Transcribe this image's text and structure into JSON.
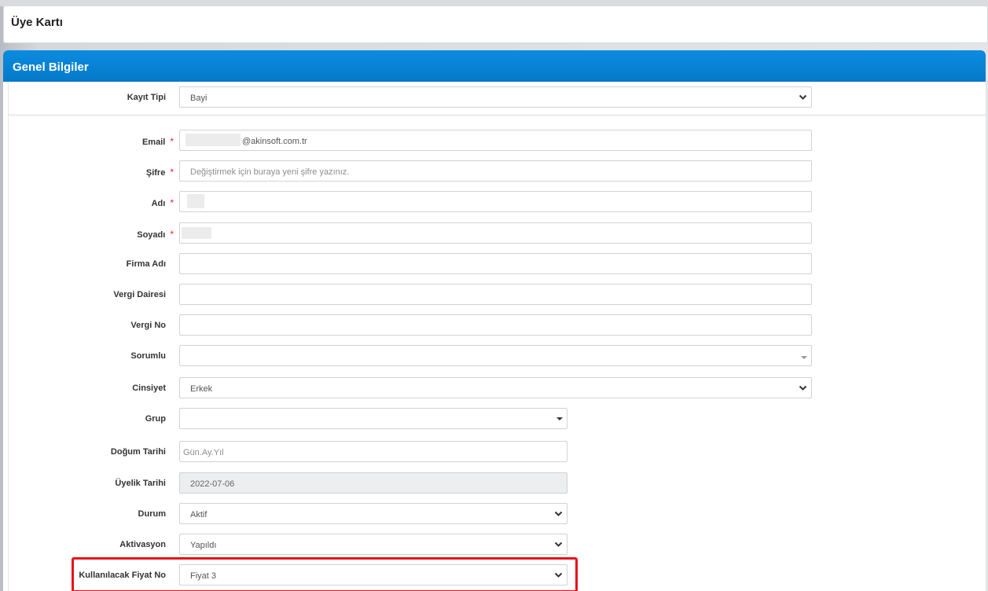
{
  "header": {
    "title": "Üye Kartı"
  },
  "panel": {
    "title": "Genel Bilgiler"
  },
  "form": {
    "kayit_tipi": {
      "label": "Kayıt Tipi",
      "value": "Bayi"
    },
    "email": {
      "label": "Email",
      "value": "@akinsoft.com.tr",
      "required": "*"
    },
    "sifre": {
      "label": "Şifre",
      "placeholder": "Değiştirmek için buraya yeni şifre yazınız.",
      "required": "*"
    },
    "adi": {
      "label": "Adı",
      "value": "",
      "required": "*"
    },
    "soyadi": {
      "label": "Soyadı",
      "value": "",
      "required": "*"
    },
    "firma_adi": {
      "label": "Firma Adı",
      "value": ""
    },
    "vergi_dairesi": {
      "label": "Vergi Dairesi",
      "value": ""
    },
    "vergi_no": {
      "label": "Vergi No",
      "value": ""
    },
    "sorumlu": {
      "label": "Sorumlu",
      "value": ""
    },
    "cinsiyet": {
      "label": "Cinsiyet",
      "value": "Erkek"
    },
    "grup": {
      "label": "Grup",
      "value": ""
    },
    "dogum_tarihi": {
      "label": "Doğum Tarihi",
      "placeholder": "Gün.Ay.Yıl"
    },
    "uyelik_tarihi": {
      "label": "Üyelik Tarihi",
      "value": "2022-07-06"
    },
    "durum": {
      "label": "Durum",
      "value": "Aktif"
    },
    "aktivasyon": {
      "label": "Aktivasyon",
      "value": "Yapıldı"
    },
    "fiyat_no": {
      "label": "Kullanılacak Fiyat No",
      "value": "Fiyat 3"
    }
  },
  "colors": {
    "header_blue": "#0a8ce0",
    "required_red": "#d9232e",
    "highlight_red": "#e8111b"
  },
  "icons": {
    "select_arrow": "chevron-down-icon",
    "small_caret": "caret-down-icon"
  }
}
